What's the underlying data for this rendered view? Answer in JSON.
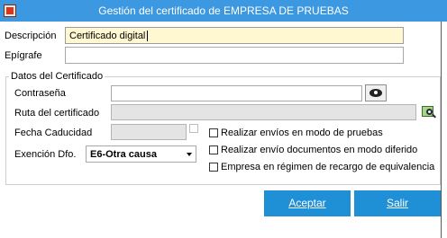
{
  "window": {
    "title": "Gestión del certificado de EMPRESA DE PRUEBAS"
  },
  "fields": {
    "descripcion": {
      "label": "Descripción",
      "value": "Certificado digital"
    },
    "epigrafe": {
      "label": "Epígrafe",
      "value": ""
    }
  },
  "group": {
    "title": "Datos del Certificado",
    "contrasena": {
      "label": "Contraseña",
      "value": ""
    },
    "ruta": {
      "label": "Ruta del certificado",
      "value": ""
    },
    "fecha": {
      "label": "Fecha Caducidad",
      "value": ""
    },
    "exencion": {
      "label": "Exención Dfo.",
      "selected": "E6-Otra causa"
    }
  },
  "checkboxes": [
    {
      "label": "Realizar envíos en modo de pruebas",
      "checked": false
    },
    {
      "label": "Realizar envío documentos en modo diferido",
      "checked": false
    },
    {
      "label": "Empresa en régimen de recargo de equivalencia",
      "checked": false
    }
  ],
  "buttons": {
    "accept": "Aceptar",
    "exit": "Salir"
  },
  "icons": {
    "app": "app-icon",
    "show_password": "eye-icon",
    "browse": "browse-file-icon",
    "dropdown": "chevron-down-icon"
  },
  "colors": {
    "titlebar": "#3c98e0",
    "button": "#1f8fd6",
    "highlight_field": "#fff8d0"
  }
}
